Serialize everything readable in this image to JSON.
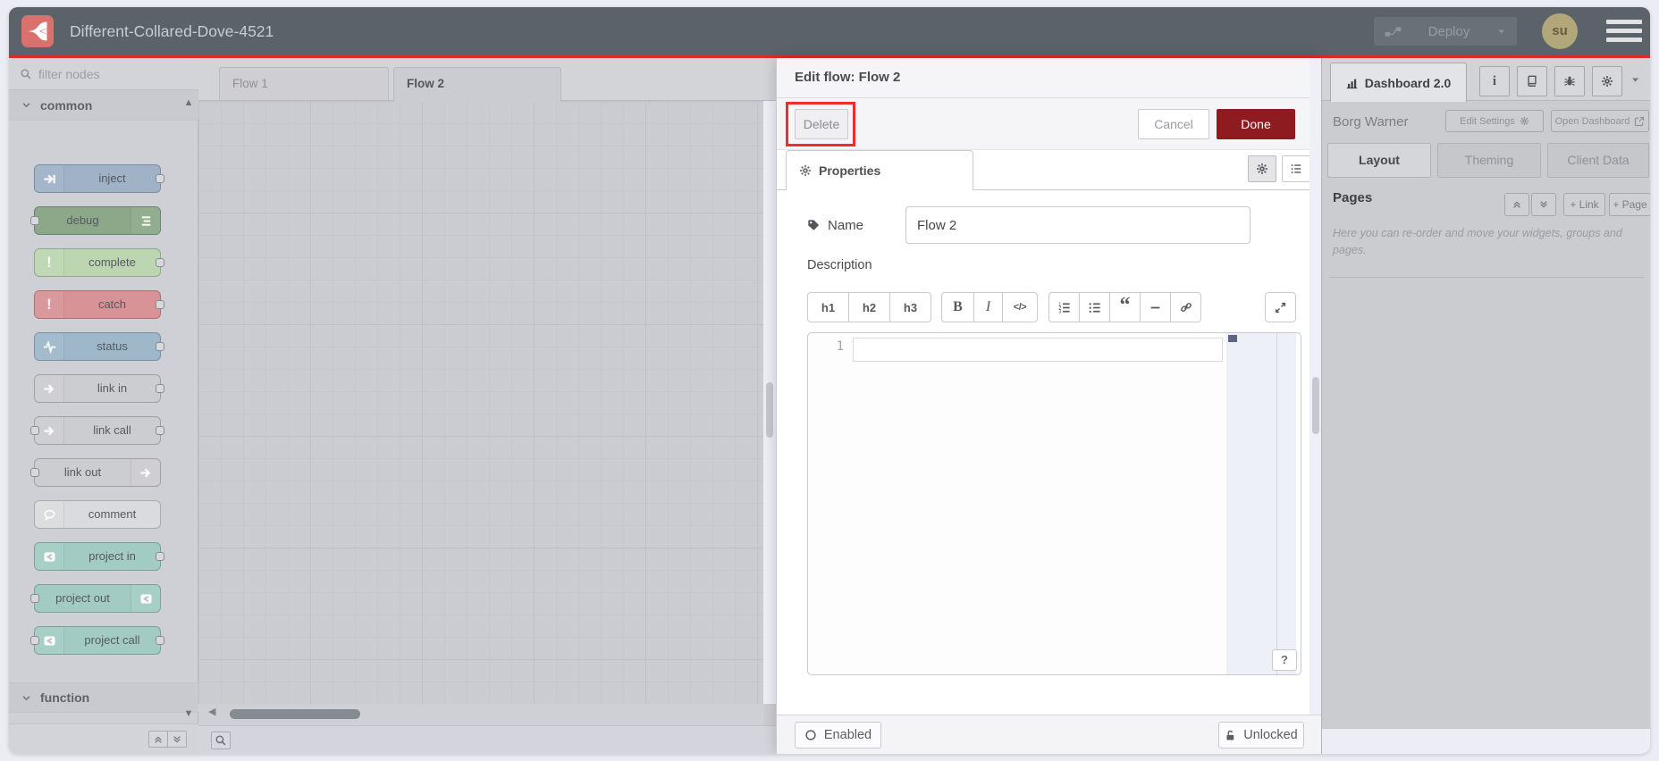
{
  "app": {
    "title": "Different-Collared-Dove-4521",
    "deploy_label": "Deploy",
    "avatar_text": "su"
  },
  "palette": {
    "filter_placeholder": "filter nodes",
    "category_common": "common",
    "category_function": "function",
    "nodes": [
      {
        "label": "inject",
        "fill": "#9fb2c6",
        "icon": "inject-arrow",
        "icon_side": "left",
        "ports": "right"
      },
      {
        "label": "debug",
        "fill": "#8ca889",
        "icon": "list",
        "icon_side": "right",
        "ports": "left"
      },
      {
        "label": "complete",
        "fill": "#bcd6b2",
        "icon": "exclaim",
        "icon_side": "left",
        "ports": "right"
      },
      {
        "label": "catch",
        "fill": "#d79396",
        "icon": "exclaim",
        "icon_side": "left",
        "ports": "right"
      },
      {
        "label": "status",
        "fill": "#9eb8ca",
        "icon": "pulse",
        "icon_side": "left",
        "ports": "right"
      },
      {
        "label": "link in",
        "fill": "#cccdd1",
        "icon": "link-arrow",
        "icon_side": "left",
        "ports": "right"
      },
      {
        "label": "link call",
        "fill": "#cccdd1",
        "icon": "link-arrow",
        "icon_side": "left",
        "ports": "both"
      },
      {
        "label": "link out",
        "fill": "#cccdd1",
        "icon": "link-arrow",
        "icon_side": "right",
        "ports": "left"
      },
      {
        "label": "comment",
        "fill": "#dadbde",
        "icon": "comment-bubble",
        "icon_side": "left",
        "ports": "none"
      },
      {
        "label": "project in",
        "fill": "#a2ccc3",
        "icon": "node-red-logo",
        "icon_side": "left",
        "ports": "right"
      },
      {
        "label": "project out",
        "fill": "#a2ccc3",
        "icon": "node-red-logo",
        "icon_side": "right",
        "ports": "left"
      },
      {
        "label": "project call",
        "fill": "#a2ccc3",
        "icon": "node-red-logo",
        "icon_side": "left",
        "ports": "both"
      }
    ]
  },
  "workspace": {
    "tabs": [
      {
        "label": "Flow 1",
        "active": false
      },
      {
        "label": "Flow 2",
        "active": true
      }
    ]
  },
  "tray": {
    "title": "Edit flow: Flow 2",
    "delete_label": "Delete",
    "cancel_label": "Cancel",
    "done_label": "Done",
    "properties_tab": "Properties",
    "name_label": "Name",
    "name_value": "Flow 2",
    "description_label": "Description",
    "md_toolbar": {
      "headings": [
        "h1",
        "h2",
        "h3"
      ],
      "bold": "B",
      "italic": "I",
      "code": "</>",
      "list_icons": [
        "ordered-list",
        "unordered-list",
        "blockquote",
        "horizontal-rule",
        "hyperlink"
      ]
    },
    "editor": {
      "line_number": "1",
      "help_label": "?"
    },
    "footer": {
      "enabled_label": "Enabled",
      "lock_label": "Unlocked"
    }
  },
  "sidebar": {
    "dashboard_tab": "Dashboard 2.0",
    "project_name": "Borg Warner",
    "edit_settings_label": "Edit Settings",
    "open_dashboard_label": "Open Dashboard",
    "tabs": [
      {
        "label": "Layout",
        "active": true
      },
      {
        "label": "Theming",
        "active": false
      },
      {
        "label": "Client Data",
        "active": false
      }
    ],
    "pages_heading": "Pages",
    "link_button": "+ Link",
    "page_button": "+ Page",
    "help_text": "Here you can re-order and move your widgets, groups and pages."
  },
  "colors": {
    "header_gray": "#5c6269",
    "accent_red_line": "#dd2a2a",
    "logo_red": "#d9716f",
    "avatar_tan": "#b2a77b",
    "done_button_red": "#8e1b20",
    "annotation_red": "#f22b2b",
    "canvas_gray": "#cbccd1"
  }
}
